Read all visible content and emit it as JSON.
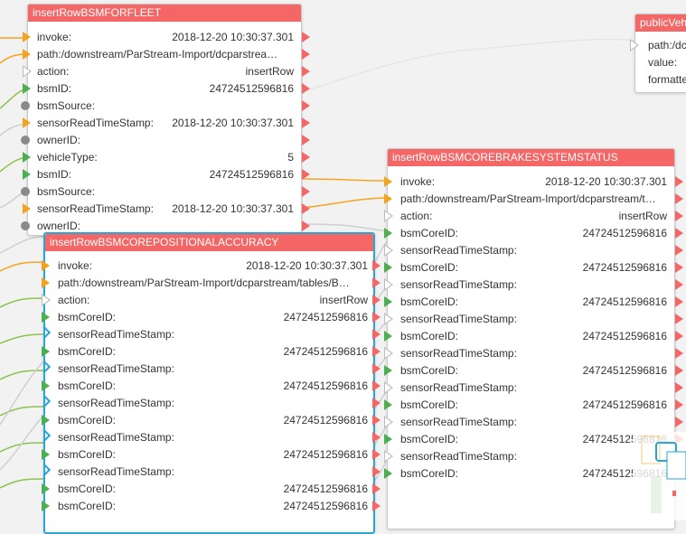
{
  "colors": {
    "title_bar": "#f46766",
    "selected_border": "#29a6d6",
    "trigger_port": "#f5a31f",
    "value_port": "#4caf50",
    "output_port": "#f46766",
    "canvas": "#f2f2f2"
  },
  "fleet_node": {
    "title": "insertRowBSMFORFLEET",
    "rows": [
      {
        "label": "invoke:",
        "value": "2018-12-20 10:30:37.301",
        "port": "trigger"
      },
      {
        "label": "path:/downstream/ParStream-Import/dcparstrea…",
        "value": "",
        "port": "trigger"
      },
      {
        "label": "action:",
        "value": "insertRow",
        "port": "empty"
      },
      {
        "label": "bsmID:",
        "value": "24724512596816",
        "port": "value"
      },
      {
        "label": "bsmSource:",
        "value": "",
        "port": "knob"
      },
      {
        "label": "sensorReadTimeStamp:",
        "value": "2018-12-20 10:30:37.301",
        "port": "trigger"
      },
      {
        "label": "ownerID:",
        "value": "",
        "port": "knob"
      },
      {
        "label": "vehicleType:",
        "value": "5",
        "port": "value"
      },
      {
        "label": "bsmID:",
        "value": "24724512596816",
        "port": "value"
      },
      {
        "label": "bsmSource:",
        "value": "",
        "port": "knob"
      },
      {
        "label": "sensorReadTimeStamp:",
        "value": "2018-12-20 10:30:37.301",
        "port": "trigger"
      },
      {
        "label": "ownerID:",
        "value": "",
        "port": "knob"
      }
    ]
  },
  "brake_node": {
    "title": "insertRowBSMCOREBRAKESYSTEMSTATUS",
    "rows": [
      {
        "label": "invoke:",
        "value": "2018-12-20 10:30:37.301",
        "port": "trigger"
      },
      {
        "label": "path:/downstream/ParStream-Import/dcparstream/t…",
        "value": "",
        "port": "trigger"
      },
      {
        "label": "action:",
        "value": "insertRow",
        "port": "empty"
      },
      {
        "label": "bsmCoreID:",
        "value": "24724512596816",
        "port": "value"
      },
      {
        "label": "sensorReadTimeStamp:",
        "value": "",
        "port": "empty"
      },
      {
        "label": "bsmCoreID:",
        "value": "24724512596816",
        "port": "value"
      },
      {
        "label": "sensorReadTimeStamp:",
        "value": "",
        "port": "empty"
      },
      {
        "label": "bsmCoreID:",
        "value": "24724512596816",
        "port": "value"
      },
      {
        "label": "sensorReadTimeStamp:",
        "value": "",
        "port": "empty"
      },
      {
        "label": "bsmCoreID:",
        "value": "24724512596816",
        "port": "value"
      },
      {
        "label": "sensorReadTimeStamp:",
        "value": "",
        "port": "empty"
      },
      {
        "label": "bsmCoreID:",
        "value": "24724512596816",
        "port": "value"
      },
      {
        "label": "sensorReadTimeStamp:",
        "value": "",
        "port": "empty"
      },
      {
        "label": "bsmCoreID:",
        "value": "24724512596816",
        "port": "value"
      },
      {
        "label": "sensorReadTimeStamp:",
        "value": "",
        "port": "empty"
      },
      {
        "label": "bsmCoreID:",
        "value": "24724512596816",
        "port": "value"
      },
      {
        "label": "sensorReadTimeStamp:",
        "value": "",
        "port": "empty"
      },
      {
        "label": "bsmCoreID:",
        "value": "24724512596816",
        "port": "value"
      }
    ]
  },
  "positional_node": {
    "title": "insertRowBSMCOREPOSITIONALACCURACY",
    "rows": [
      {
        "label": "invoke:",
        "value": "2018-12-20 10:30:37.301",
        "port": "trigger"
      },
      {
        "label": "path:/downstream/ParStream-Import/dcparstream/tables/B…",
        "value": "",
        "port": "trigger"
      },
      {
        "label": "action:",
        "value": "insertRow",
        "port": "empty"
      },
      {
        "label": "bsmCoreID:",
        "value": "24724512596816",
        "port": "value"
      },
      {
        "label": "sensorReadTimeStamp:",
        "value": "",
        "port": "chevron"
      },
      {
        "label": "bsmCoreID:",
        "value": "24724512596816",
        "port": "value"
      },
      {
        "label": "sensorReadTimeStamp:",
        "value": "",
        "port": "chevron"
      },
      {
        "label": "bsmCoreID:",
        "value": "24724512596816",
        "port": "value"
      },
      {
        "label": "sensorReadTimeStamp:",
        "value": "",
        "port": "chevron"
      },
      {
        "label": "bsmCoreID:",
        "value": "24724512596816",
        "port": "value"
      },
      {
        "label": "sensorReadTimeStamp:",
        "value": "",
        "port": "chevron"
      },
      {
        "label": "bsmCoreID:",
        "value": "24724512596816",
        "port": "value"
      },
      {
        "label": "sensorReadTimeStamp:",
        "value": "",
        "port": "chevron"
      },
      {
        "label": "bsmCoreID:",
        "value": "24724512596816",
        "port": "value"
      },
      {
        "label": "bsmCoreID:",
        "value": "24724512596816",
        "port": "value"
      }
    ]
  },
  "public_node": {
    "title": "publicVeh",
    "rows": [
      {
        "label": "path:/dc"
      },
      {
        "label": "value:"
      },
      {
        "label": "formatte"
      }
    ]
  }
}
